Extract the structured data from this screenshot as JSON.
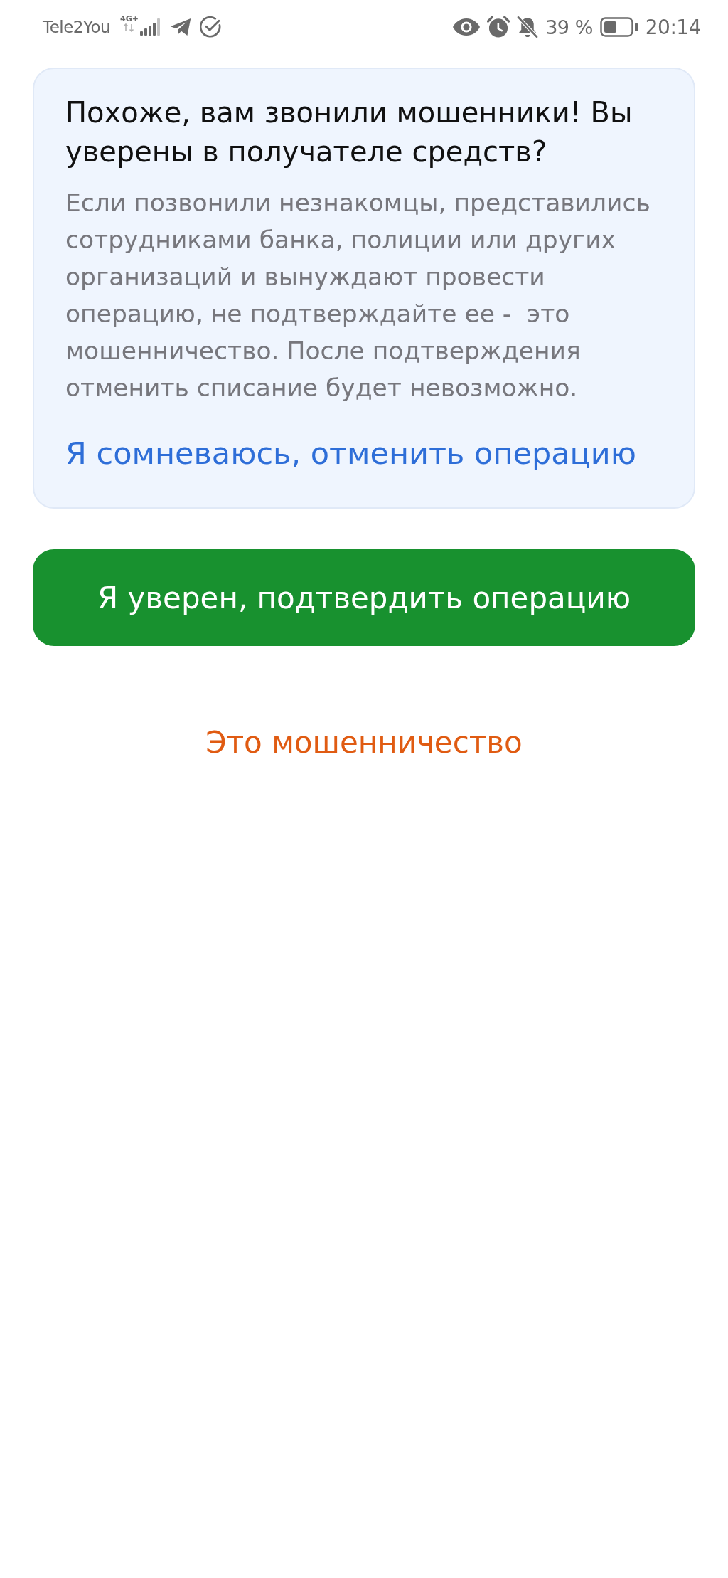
{
  "status_bar": {
    "carrier": "Tele2You",
    "network": "4G+",
    "battery": "39 %",
    "time": "20:14"
  },
  "warning_card": {
    "title": "Похоже, вам звонили мошенники! Вы уверены в получателе средств?",
    "body": "Если позвонили незнакомцы, представились сотрудниками банка, полиции или других организаций и вынуждают провести операцию, не подтверждайте ее -  это мошенничество. После подтверждения отменить списание будет невозможно.",
    "cancel_link": "Я сомневаюсь, отменить операцию"
  },
  "confirm_button": "Я уверен, подтвердить операцию",
  "fraud_link": "Это мошенничество"
}
